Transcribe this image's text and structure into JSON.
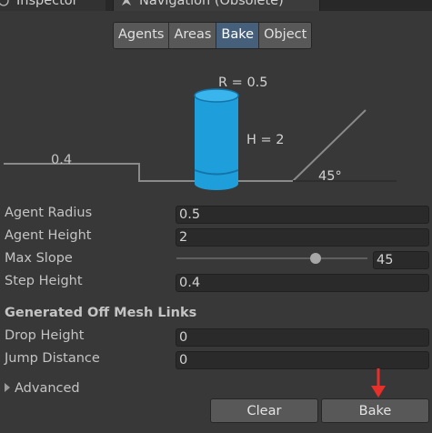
{
  "window_tabs": [
    {
      "label": "Inspector",
      "icon": "info-icon"
    },
    {
      "label": "Navigation (Obsolete)",
      "icon": "navigation-icon"
    }
  ],
  "toolbar": {
    "tabs": [
      "Agents",
      "Areas",
      "Bake",
      "Object"
    ],
    "active": "Bake"
  },
  "diagram": {
    "radius_label": "R = 0.5",
    "height_label": "H = 2",
    "step_label": "0.4",
    "slope_label": "45°",
    "agent_color": "#1ea0dc"
  },
  "baked_agent_size": {
    "agent_radius": {
      "label": "Agent Radius",
      "value": "0.5"
    },
    "agent_height": {
      "label": "Agent Height",
      "value": "2"
    },
    "max_slope": {
      "label": "Max Slope",
      "value": "45",
      "slider_min": 0,
      "slider_max": 60
    },
    "step_height": {
      "label": "Step Height",
      "value": "0.4"
    }
  },
  "off_mesh_links": {
    "title": "Generated Off Mesh Links",
    "drop_height": {
      "label": "Drop Height",
      "value": "0"
    },
    "jump_distance": {
      "label": "Jump Distance",
      "value": "0"
    }
  },
  "advanced": {
    "label": "Advanced",
    "expanded": false
  },
  "buttons": {
    "clear": "Clear",
    "bake": "Bake"
  },
  "annotation": {
    "arrow_color": "#e8302a"
  }
}
